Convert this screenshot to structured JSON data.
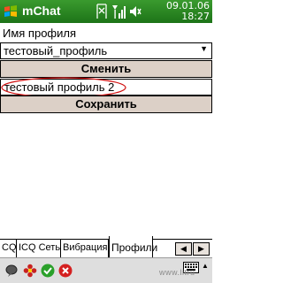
{
  "titlebar": {
    "app_title": "mChat",
    "date": "09.01.06",
    "time": "18:27",
    "icons": [
      "windows-start-icon",
      "signal-edge-icon",
      "network-signal-icon",
      "volume-icon"
    ]
  },
  "form": {
    "profile_label": "Имя профиля",
    "profile_select_value": "тестовый_профиль",
    "switch_button": "Сменить",
    "profile_name_value": "тестовый профиль 2",
    "save_button": "Сохранить"
  },
  "tabs": {
    "items": [
      "CQ",
      "ICQ Сеть",
      "Вибрация",
      "Профили"
    ],
    "active": "Профили"
  },
  "toolbar": {
    "icons": [
      "chat-bubble-icon",
      "flower-status-icon",
      "check-icon",
      "close-icon",
      "keyboard-icon"
    ]
  },
  "watermark": "www.litru",
  "colors": {
    "titlebar": "#2a8a22",
    "button_bg": "#dcd0c7",
    "highlight_oval": "#d01010"
  }
}
